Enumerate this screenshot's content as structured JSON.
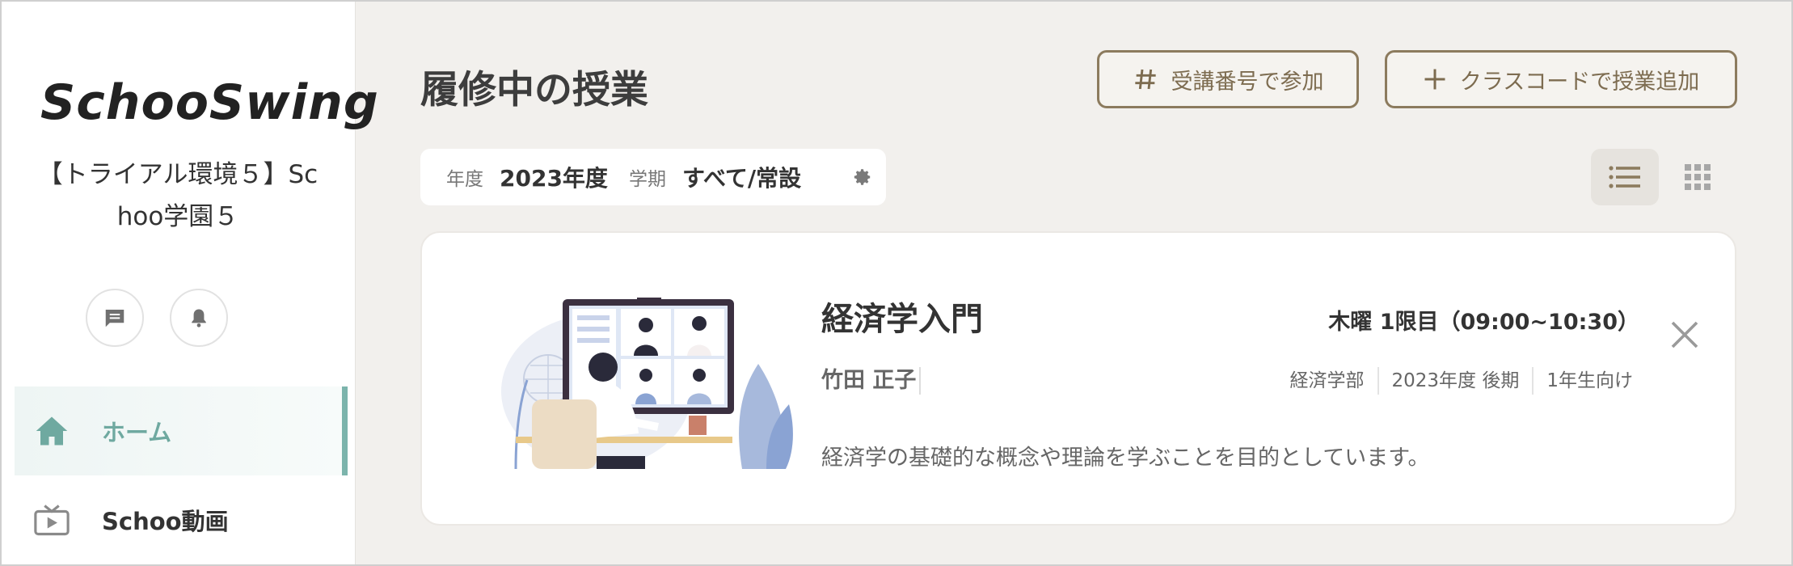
{
  "sidebar": {
    "logo_text": "SchooSwing",
    "org_name": "【トライアル環境５】Schoo学園５",
    "actions": [
      {
        "icon": "message-icon"
      },
      {
        "icon": "bell-icon"
      }
    ],
    "nav": {
      "home": {
        "label": "ホーム",
        "icon": "home-icon",
        "active": true
      },
      "video": {
        "label": "Schoo動画",
        "icon": "tv-icon"
      }
    }
  },
  "header": {
    "title": "履修中の授業",
    "join_button": "受講番号で参加",
    "add_button": "クラスコードで授業追加"
  },
  "filter": {
    "year_label": "年度",
    "year_value": "2023年度",
    "term_label": "学期",
    "term_value": "すべて/常設"
  },
  "view_toggle": {
    "selected": "list"
  },
  "courses": [
    {
      "title": "経済学入門",
      "teacher": "竹田 正子",
      "schedule": "木曜 1限目（09:00~10:30）",
      "faculty": "経済学部",
      "term": "2023年度 後期",
      "target": "1年生向け",
      "description": "経済学の基礎的な概念や理論を学ぶことを目的としています。"
    }
  ],
  "colors": {
    "accent": "#7cb4ac",
    "button_border": "#8c7b5e",
    "background": "#f2f0ed"
  }
}
